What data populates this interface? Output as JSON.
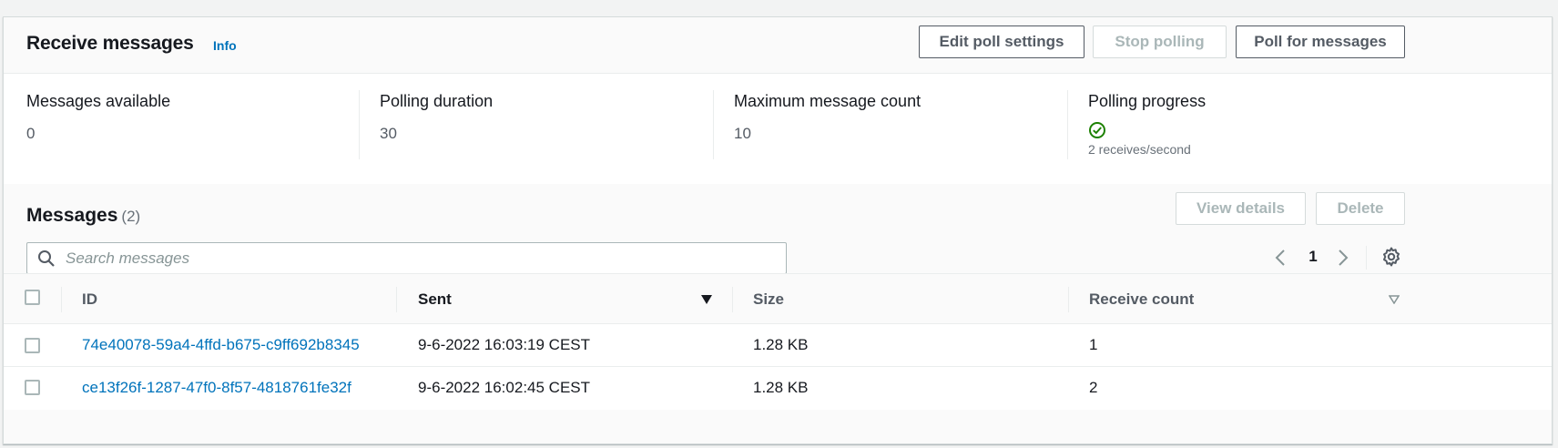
{
  "header": {
    "title": "Receive messages",
    "info_label": "Info",
    "buttons": {
      "edit_poll_settings": "Edit poll settings",
      "stop_polling": "Stop polling",
      "poll_for_messages": "Poll for messages"
    }
  },
  "stats": [
    {
      "label": "Messages available",
      "value": "0"
    },
    {
      "label": "Polling duration",
      "value": "30"
    },
    {
      "label": "Maximum message count",
      "value": "10"
    },
    {
      "label": "Polling progress",
      "status_icon": "check-circle-icon",
      "sub": "2 receives/second"
    }
  ],
  "messages": {
    "title": "Messages",
    "count": "(2)",
    "buttons": {
      "view_details": "View details",
      "delete": "Delete"
    },
    "search": {
      "placeholder": "Search messages",
      "value": ""
    },
    "pagination": {
      "current_page": "1"
    },
    "columns": [
      {
        "label": "ID"
      },
      {
        "label": "Sent",
        "sort": "descending"
      },
      {
        "label": "Size"
      },
      {
        "label": "Receive count"
      }
    ],
    "rows": [
      {
        "id": "74e40078-59a4-4ffd-b675-c9ff692b8345",
        "sent": "9-6-2022 16:03:19 CEST",
        "size": "1.28 KB",
        "receive_count": "1"
      },
      {
        "id": "ce13f26f-1287-47f0-8f57-4818761fe32f",
        "sent": "9-6-2022 16:02:45 CEST",
        "size": "1.28 KB",
        "receive_count": "2"
      }
    ]
  },
  "colors": {
    "link": "#0073bb",
    "success": "#1d8102",
    "text": "#16191f",
    "muted": "#687078",
    "disabled": "#aab7b8"
  }
}
